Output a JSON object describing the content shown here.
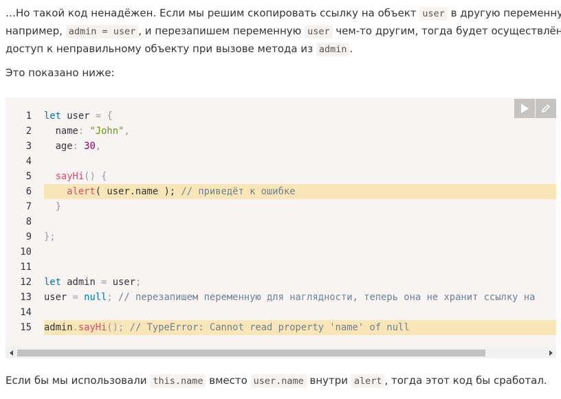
{
  "para1": {
    "t1": "…Но такой код ненадёжен. Если мы решим скопировать ссылку на объект ",
    "c1": "user",
    "t2": " в другую переменную,",
    "t3": "например, ",
    "c2": "admin = user",
    "t4": ", и перезапишем переменную ",
    "c3": "user",
    "t5": " чем-то другим, тогда будет осуществлён",
    "t6": "доступ к неправильному объекту при вызове метода из ",
    "c4": "admin",
    "t7": "."
  },
  "para2": "Это показано ниже:",
  "code": {
    "line_numbers": [
      "1",
      "2",
      "3",
      "4",
      "5",
      "6",
      "7",
      "8",
      "9",
      "10",
      "11",
      "12",
      "13",
      "14",
      "15"
    ],
    "l1": {
      "kw": "let",
      "t": " user ",
      "op": "=",
      "p": " {"
    },
    "l2": {
      "indent": "  ",
      "prop": "name",
      "p": ": ",
      "str": "\"John\"",
      "p2": ","
    },
    "l3": {
      "indent": "  ",
      "prop": "age",
      "p": ": ",
      "num": "30",
      "p2": ","
    },
    "l5": {
      "indent": "  ",
      "fn": "sayHi",
      "p": "() {"
    },
    "l6": {
      "indent": "    ",
      "fn": "alert",
      "p": "( user.name ); ",
      "cm": "// приведёт к ошибке"
    },
    "l7": {
      "indent": "  ",
      "p": "}"
    },
    "l9": {
      "p": "};"
    },
    "l12": {
      "kw": "let",
      "t": " admin ",
      "op": "=",
      "t2": " user",
      "p": ";"
    },
    "l13": {
      "t": "user ",
      "op": "=",
      "kw": " null",
      "p": "; ",
      "cm": "// перезапишем переменную для наглядности, теперь она не хранит ссылку на"
    },
    "l15": {
      "t": "admin",
      "p": ".",
      "fn": "sayHi",
      "p2": "(); ",
      "cm": "// TypeError: Cannot read property 'name' of null"
    }
  },
  "toolbar": {
    "run_icon": "play-icon",
    "edit_icon": "pencil-icon"
  },
  "scroll": {
    "left_icon": "arrow-left-icon",
    "right_icon": "arrow-right-icon"
  },
  "para3": {
    "t1": "Если бы мы использовали ",
    "c1": "this.name",
    "t2": " вместо ",
    "c2": "user.name",
    "t3": " внутри ",
    "c3": "alert",
    "t4": ", тогда этот код бы сработал."
  }
}
